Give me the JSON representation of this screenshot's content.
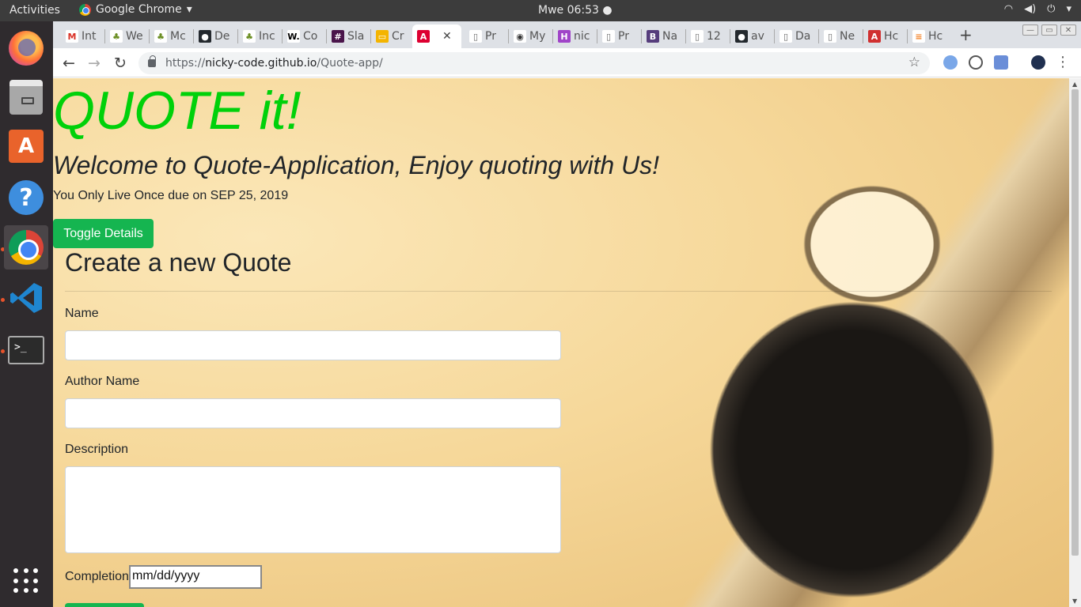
{
  "system": {
    "activities": "Activities",
    "app_name": "Google Chrome",
    "clock": "Mwe 06:53 ●",
    "tray": [
      "wifi",
      "volume",
      "power",
      "▾"
    ]
  },
  "dock": {
    "items": [
      "firefox",
      "files",
      "software-store",
      "help",
      "chrome",
      "vscode",
      "terminal",
      "show-apps"
    ]
  },
  "browser": {
    "tabs": [
      {
        "label": "Int",
        "icon": "gmail"
      },
      {
        "label": "We",
        "icon": "leaf"
      },
      {
        "label": "Mc",
        "icon": "leaf"
      },
      {
        "label": "De",
        "icon": "github"
      },
      {
        "label": "Inc",
        "icon": "leaf"
      },
      {
        "label": "Co",
        "icon": "w"
      },
      {
        "label": "Sla",
        "icon": "slack"
      },
      {
        "label": "Cr",
        "icon": "slides"
      },
      {
        "label": "",
        "icon": "angular"
      },
      {
        "label": "Pr",
        "icon": "doc"
      },
      {
        "label": "My",
        "icon": "mw"
      },
      {
        "label": "nic",
        "icon": "h"
      },
      {
        "label": "Pr",
        "icon": "doc"
      },
      {
        "label": "Na",
        "icon": "b"
      },
      {
        "label": "12",
        "icon": "doc"
      },
      {
        "label": "av",
        "icon": "github"
      },
      {
        "label": "Da",
        "icon": "doc"
      },
      {
        "label": "Ne",
        "icon": "doc"
      },
      {
        "label": "Hc",
        "icon": "a"
      },
      {
        "label": "Hc",
        "icon": "stack"
      }
    ],
    "url_scheme": "https://",
    "url_host": "nicky-code.github.io",
    "url_path": "/Quote-app/"
  },
  "page": {
    "title": "QUOTE it!",
    "subtitle": "Welcome to Quote-Application, Enjoy quoting with Us!",
    "quote_line": "You Only Live Once due on SEP 25, 2019",
    "toggle_button": "Toggle Details",
    "form_title": "Create a new Quote",
    "name_label": "Name",
    "author_label": "Author Name",
    "description_label": "Description",
    "completion_label": "Completion",
    "completion_placeholder": "mm/dd/yyyy"
  },
  "colors": {
    "title_green": "#00d10a",
    "button_green": "#15b550"
  }
}
